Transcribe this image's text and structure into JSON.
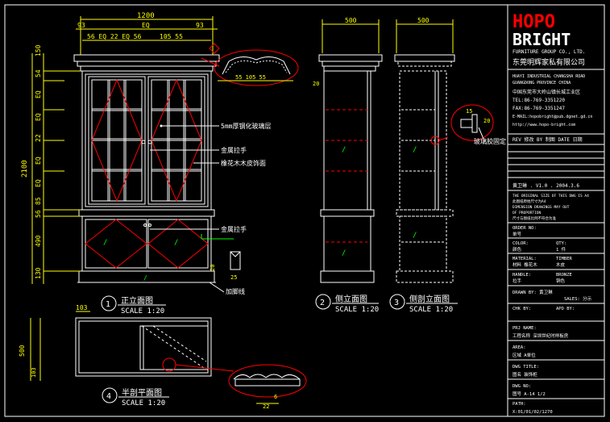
{
  "brand": {
    "logo_line1": "HOPO",
    "logo_line2": "BRIGHT",
    "tagline": "FURNITURE GROUP CO., LTD.",
    "company_cn": "东莞明辉家私有限公司",
    "address_en1": "HUAYI INDUSTRIAL CHANGSHA ROAD",
    "address_en2": "GUANGDONG PROVINCE CHINA",
    "address_cn": "中国东莞市大岭山镇长城工业区",
    "tel": "TEL:86-769-3351220",
    "fax": "FAX:86-769-3351247",
    "email": "E-MAIL:hopobright@pub.dgnet.gd.cn",
    "web": "http://www.hopo-bright.com"
  },
  "revision": {
    "header": "REV 修改  BY 制图  DATE 日期"
  },
  "title_block": {
    "version": "黄卫琳 . V1.0 . 2004.3.6",
    "note1": "THE ORIGINAL SIZE OF THIS DWG IS A4",
    "note2": "此图纸原始尺寸为A4",
    "note3": "DIMENSION DRAWINGS MAY OUT",
    "note4": "OF PROPORTION",
    "note5": "尺寸与图纸比例不符合为准",
    "order_label": "ORDER NO:",
    "order_cn": "单号",
    "color_label": "COLOR:",
    "color_cn": "颜色",
    "qty_label": "QTY:",
    "qty_value": "1 件",
    "material_label": "MATERIAL:",
    "material_cn": "材料  橡花木",
    "material_value": "TIMBER",
    "material_value_cn": "木皮",
    "handle_label": "HANDLE:",
    "handle_value": "BRONZE",
    "handle_cn": "拉手",
    "handle_value_cn": "铜色",
    "designer_label": "DRAWN BY: 黄卫琳",
    "sale_label": "SALES: 分示",
    "check_label": "CHK BY:",
    "appd_label": "APD BY:",
    "proj_label": "PRJ NAME:",
    "proj_value": "工程名称  深圳世纪时样板房",
    "area_label": "AREA:",
    "area_value": "区域  A单位",
    "title_label": "DWG TITLE:",
    "title_value": "图名  装饰柜",
    "dwg_no_label": "DWG NO:",
    "dwg_no_value": "图号  A-14  1/2",
    "path_label": "PATH:",
    "path_value": "X:01/01/02/1270"
  },
  "annotations": {
    "glass": "5mm厚钢化玻璃层",
    "handle_top": "金属拉手",
    "veneer": "橡花木木皮饰面",
    "handle_bottom": "金属拉手",
    "plinth": "加脚线",
    "glass_stop": "玻璃胶固定"
  },
  "dimensions": {
    "front_width": "1200",
    "front_top_left": "93",
    "front_top_eq": "EQ",
    "front_top_right": "93",
    "front_sub": "56 EQ 22 EQ 56",
    "front_sub_right": "105 55",
    "front_height": "2100",
    "front_h_parts": [
      "150",
      "54",
      "EQ",
      "EQ",
      "22",
      "EQ",
      "EQ",
      "85",
      "56",
      "490",
      "130"
    ],
    "side_width": "500",
    "section_width": "500",
    "detail_top": "55   105   55",
    "detail_side_20": "20",
    "detail_side_15": "15",
    "plinth_20": "20",
    "plinth_25": "25",
    "plan_103": "103",
    "plan_500": "500",
    "plan_103b": "103",
    "plan_22": "22",
    "plan_6": "6",
    "side_20": "20"
  },
  "views": [
    {
      "num": "1",
      "title": "正立面图",
      "scale": "SCALE 1:20"
    },
    {
      "num": "2",
      "title": "侧立面图",
      "scale": "SCALE 1:20"
    },
    {
      "num": "3",
      "title": "侧剖立面图",
      "scale": "SCALE 1:20"
    },
    {
      "num": "4",
      "title": "半剖平面图",
      "scale": "SCALE 1:20"
    }
  ],
  "colors": {
    "background": "#000000",
    "line": "#ffffff",
    "dim": "#ffff00",
    "accent": "#ff0000",
    "leader": "#00ff00",
    "logo": "#ff0000"
  }
}
